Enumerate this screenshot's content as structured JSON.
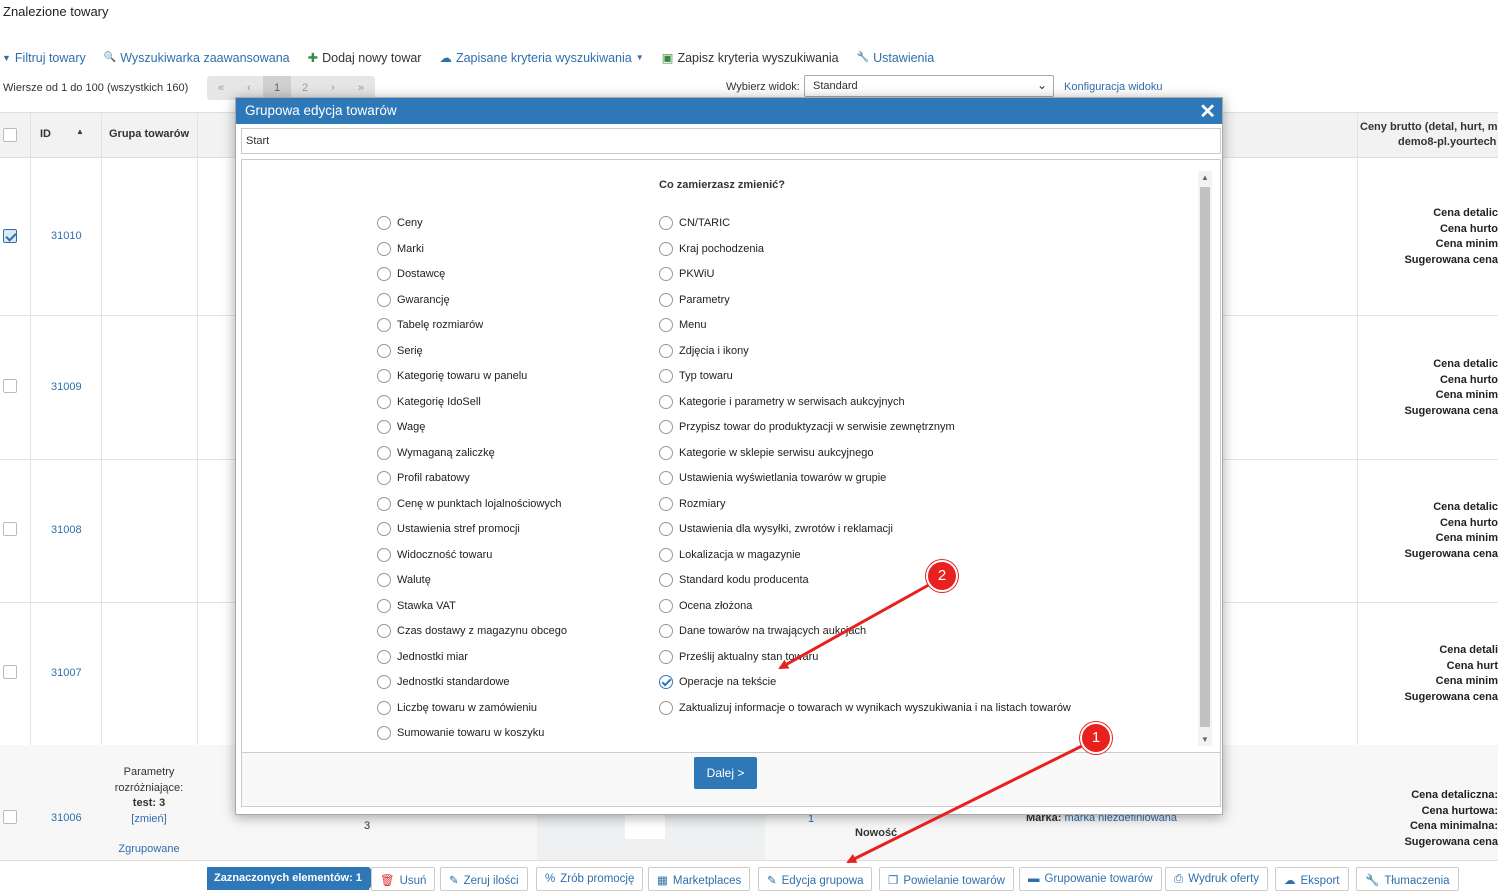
{
  "page": {
    "title": "Znalezione towary"
  },
  "toolbar": {
    "items": [
      {
        "icon": "filter-icon",
        "glyph": "▼",
        "label": "Filtruj towary"
      },
      {
        "icon": "search-icon",
        "glyph": "🔍",
        "label": "Wyszukiwarka zaawansowana"
      },
      {
        "icon": "plus-icon",
        "glyph": "✚",
        "label": "Dodaj nowy towar"
      },
      {
        "icon": "cloud-icon",
        "glyph": "☁",
        "label": "Zapisane kryteria wyszukiwania"
      },
      {
        "icon": "save-icon",
        "glyph": "▣",
        "label": "Zapisz kryteria wyszukiwania"
      },
      {
        "icon": "wrench-icon",
        "glyph": "🔧",
        "label": "Ustawienia"
      }
    ]
  },
  "list": {
    "rows_info": "Wiersze od 1 do 100 (wszystkich 160)",
    "pager": [
      "«",
      "‹",
      "1",
      "2",
      "›",
      "»"
    ],
    "view_label": "Wybierz widok:",
    "view_value": "Standard",
    "view_config": "Konfiguracja widoku"
  },
  "table": {
    "headers": {
      "id": "ID",
      "group": "Grupa towarów",
      "prices": "Ceny brutto (detal, hurt, mi",
      "prices2": "demo8-pl.yourtech"
    },
    "rows": [
      {
        "id": "31010",
        "checked": true,
        "prices": [
          "Cena detalic",
          "Cena hurto",
          "Cena minim",
          "Sugerowana cena"
        ]
      },
      {
        "id": "31009",
        "checked": false,
        "prices": [
          "Cena detalic",
          "Cena hurto",
          "Cena minim",
          "Sugerowana cena"
        ]
      },
      {
        "id": "31008",
        "checked": false,
        "prices": [
          "Cena detalic",
          "Cena hurto",
          "Cena minim",
          "Sugerowana cena"
        ]
      },
      {
        "id": "31007",
        "checked": false,
        "prices": [
          "Cena detali",
          "Cena hurt",
          "Cena minim",
          "Sugerowana cena"
        ]
      },
      {
        "id": "31006",
        "checked": false,
        "prices": [
          "Cena detaliczna:",
          "Cena hurtowa:",
          "Cena minimalna:",
          "Sugerowana cena"
        ]
      }
    ],
    "last_row": {
      "params_label": "Parametry rozróżniające:",
      "params_value": "test: 3",
      "change_link": "[zmień]",
      "grouped": "Zgrupowane",
      "qty": "3",
      "brand_label": "Marka:",
      "brand_value": "marka niezdefiniowana",
      "new_label": "Nowość",
      "one": "1"
    }
  },
  "modal": {
    "title": "Grupowa edycja towarów",
    "breadcrumb": "Start",
    "question": "Co zamierzasz zmienić?",
    "left_options": [
      "Ceny",
      "Marki",
      "Dostawcę",
      "Gwarancję",
      "Tabelę rozmiarów",
      "Serię",
      "Kategorię towaru w panelu",
      "Kategorię IdoSell",
      "Wagę",
      "Wymaganą zaliczkę",
      "Profil rabatowy",
      "Cenę w punktach lojalnościowych",
      "Ustawienia stref promocji",
      "Widoczność towaru",
      "Walutę",
      "Stawka VAT",
      "Czas dostawy z magazynu obcego",
      "Jednostki miar",
      "Jednostki standardowe",
      "Liczbę towaru w zamówieniu",
      "Sumowanie towaru w koszyku"
    ],
    "right_options": [
      "CN/TARIC",
      "Kraj pochodzenia",
      "PKWiU",
      "Parametry",
      "Menu",
      "Zdjęcia i ikony",
      "Typ towaru",
      "Kategorie i parametry w serwisach aukcyjnych",
      "Przypisz towar do produktyzacji w serwisie zewnętrznym",
      "Kategorie w sklepie serwisu aukcyjnego",
      "Ustawienia wyświetlania towarów w grupie",
      "Rozmiary",
      "Ustawienia dla wysyłki, zwrotów i reklamacji",
      "Lokalizacja w magazynie",
      "Standard kodu producenta",
      "Ocena złożona",
      "Dane towarów na trwających aukcjach",
      "Prześlij aktualny stan towaru",
      "Operacje na tekście",
      "Zaktualizuj informacje o towarach w wynikach wyszukiwania i na listach towarów"
    ],
    "selected": "Operacje na tekście",
    "next_label": "Dalej >"
  },
  "bottom_bar": {
    "selected_count": "Zaznaczonych elementów: 1",
    "buttons": [
      {
        "icon": "trash-icon",
        "glyph": "🗑",
        "label": "Usuń"
      },
      {
        "icon": "eraser-icon",
        "glyph": "✎",
        "label": "Zeruj ilości"
      },
      {
        "icon": "percent-icon",
        "glyph": "%",
        "label": "Zrób promocję"
      },
      {
        "icon": "marketplace-icon",
        "glyph": "▦",
        "label": "Marketplaces"
      },
      {
        "icon": "edit-icon",
        "glyph": "✎",
        "label": "Edycja grupowa"
      },
      {
        "icon": "copy-icon",
        "glyph": "❐",
        "label": "Powielanie towarów"
      },
      {
        "icon": "folder-icon",
        "glyph": "▬",
        "label": "Grupowanie towarów"
      },
      {
        "icon": "print-icon",
        "glyph": "⎙",
        "label": "Wydruk oferty"
      },
      {
        "icon": "cloud-upload-icon",
        "glyph": "☁",
        "label": "Eksport"
      },
      {
        "icon": "wrench-icon",
        "glyph": "🔧",
        "label": "Tłumaczenia"
      }
    ]
  },
  "annotations": {
    "badge1": "1",
    "badge2": "2",
    "arrow_color": "#e8211f"
  }
}
